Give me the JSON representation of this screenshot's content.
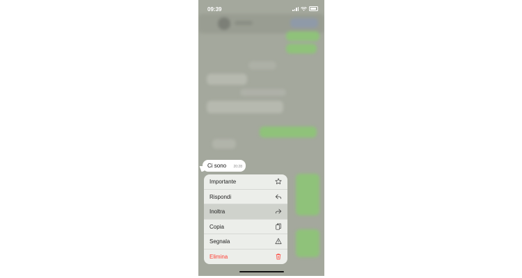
{
  "status_bar": {
    "time": "09:39"
  },
  "message": {
    "text": "Ci sono",
    "time": "20:28"
  },
  "menu": {
    "items": [
      {
        "label": "Importante",
        "icon": "star-icon"
      },
      {
        "label": "Rispondi",
        "icon": "reply-icon"
      },
      {
        "label": "Inoltra",
        "icon": "forward-icon",
        "state": "highlighted"
      },
      {
        "label": "Copia",
        "icon": "copy-icon"
      },
      {
        "label": "Segnala",
        "icon": "warning-icon"
      },
      {
        "label": "Elimina",
        "icon": "trash-icon",
        "color": "#ff3b30"
      }
    ]
  },
  "colors": {
    "background_dim": "#a4a89d",
    "menu_bg": "#eceeea",
    "destructive": "#ff3b30",
    "outgoing_bubble": "#8fc27a"
  }
}
